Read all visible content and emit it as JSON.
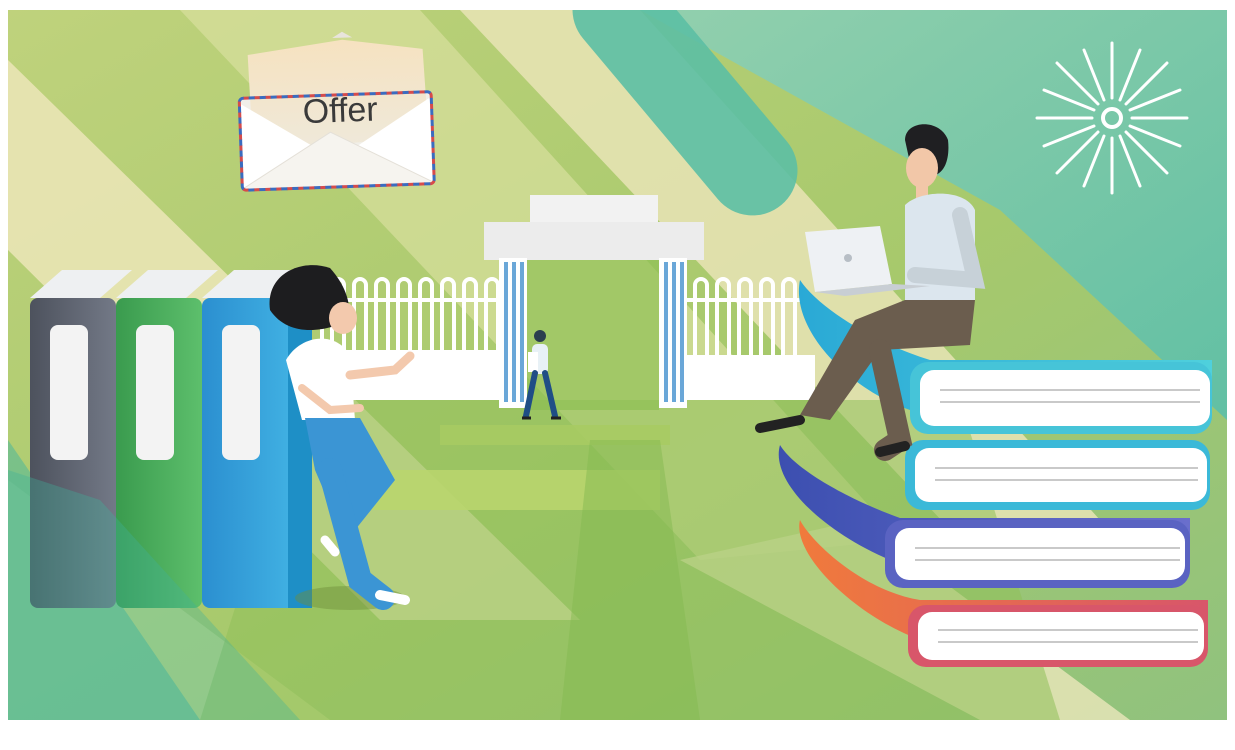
{
  "illustration": {
    "envelope": {
      "label": "Offer"
    },
    "colors": {
      "background_green": "#a9c96a",
      "cream": "#ece6b8",
      "teal": "#7cc6b0",
      "book_gray": "#5f6470",
      "book_green": "#49ad5d",
      "book_blue": "#2f9fd6",
      "book_red": "#e0645a",
      "book_indigo": "#4a58b8",
      "book_cyan": "#38bcd8"
    }
  }
}
